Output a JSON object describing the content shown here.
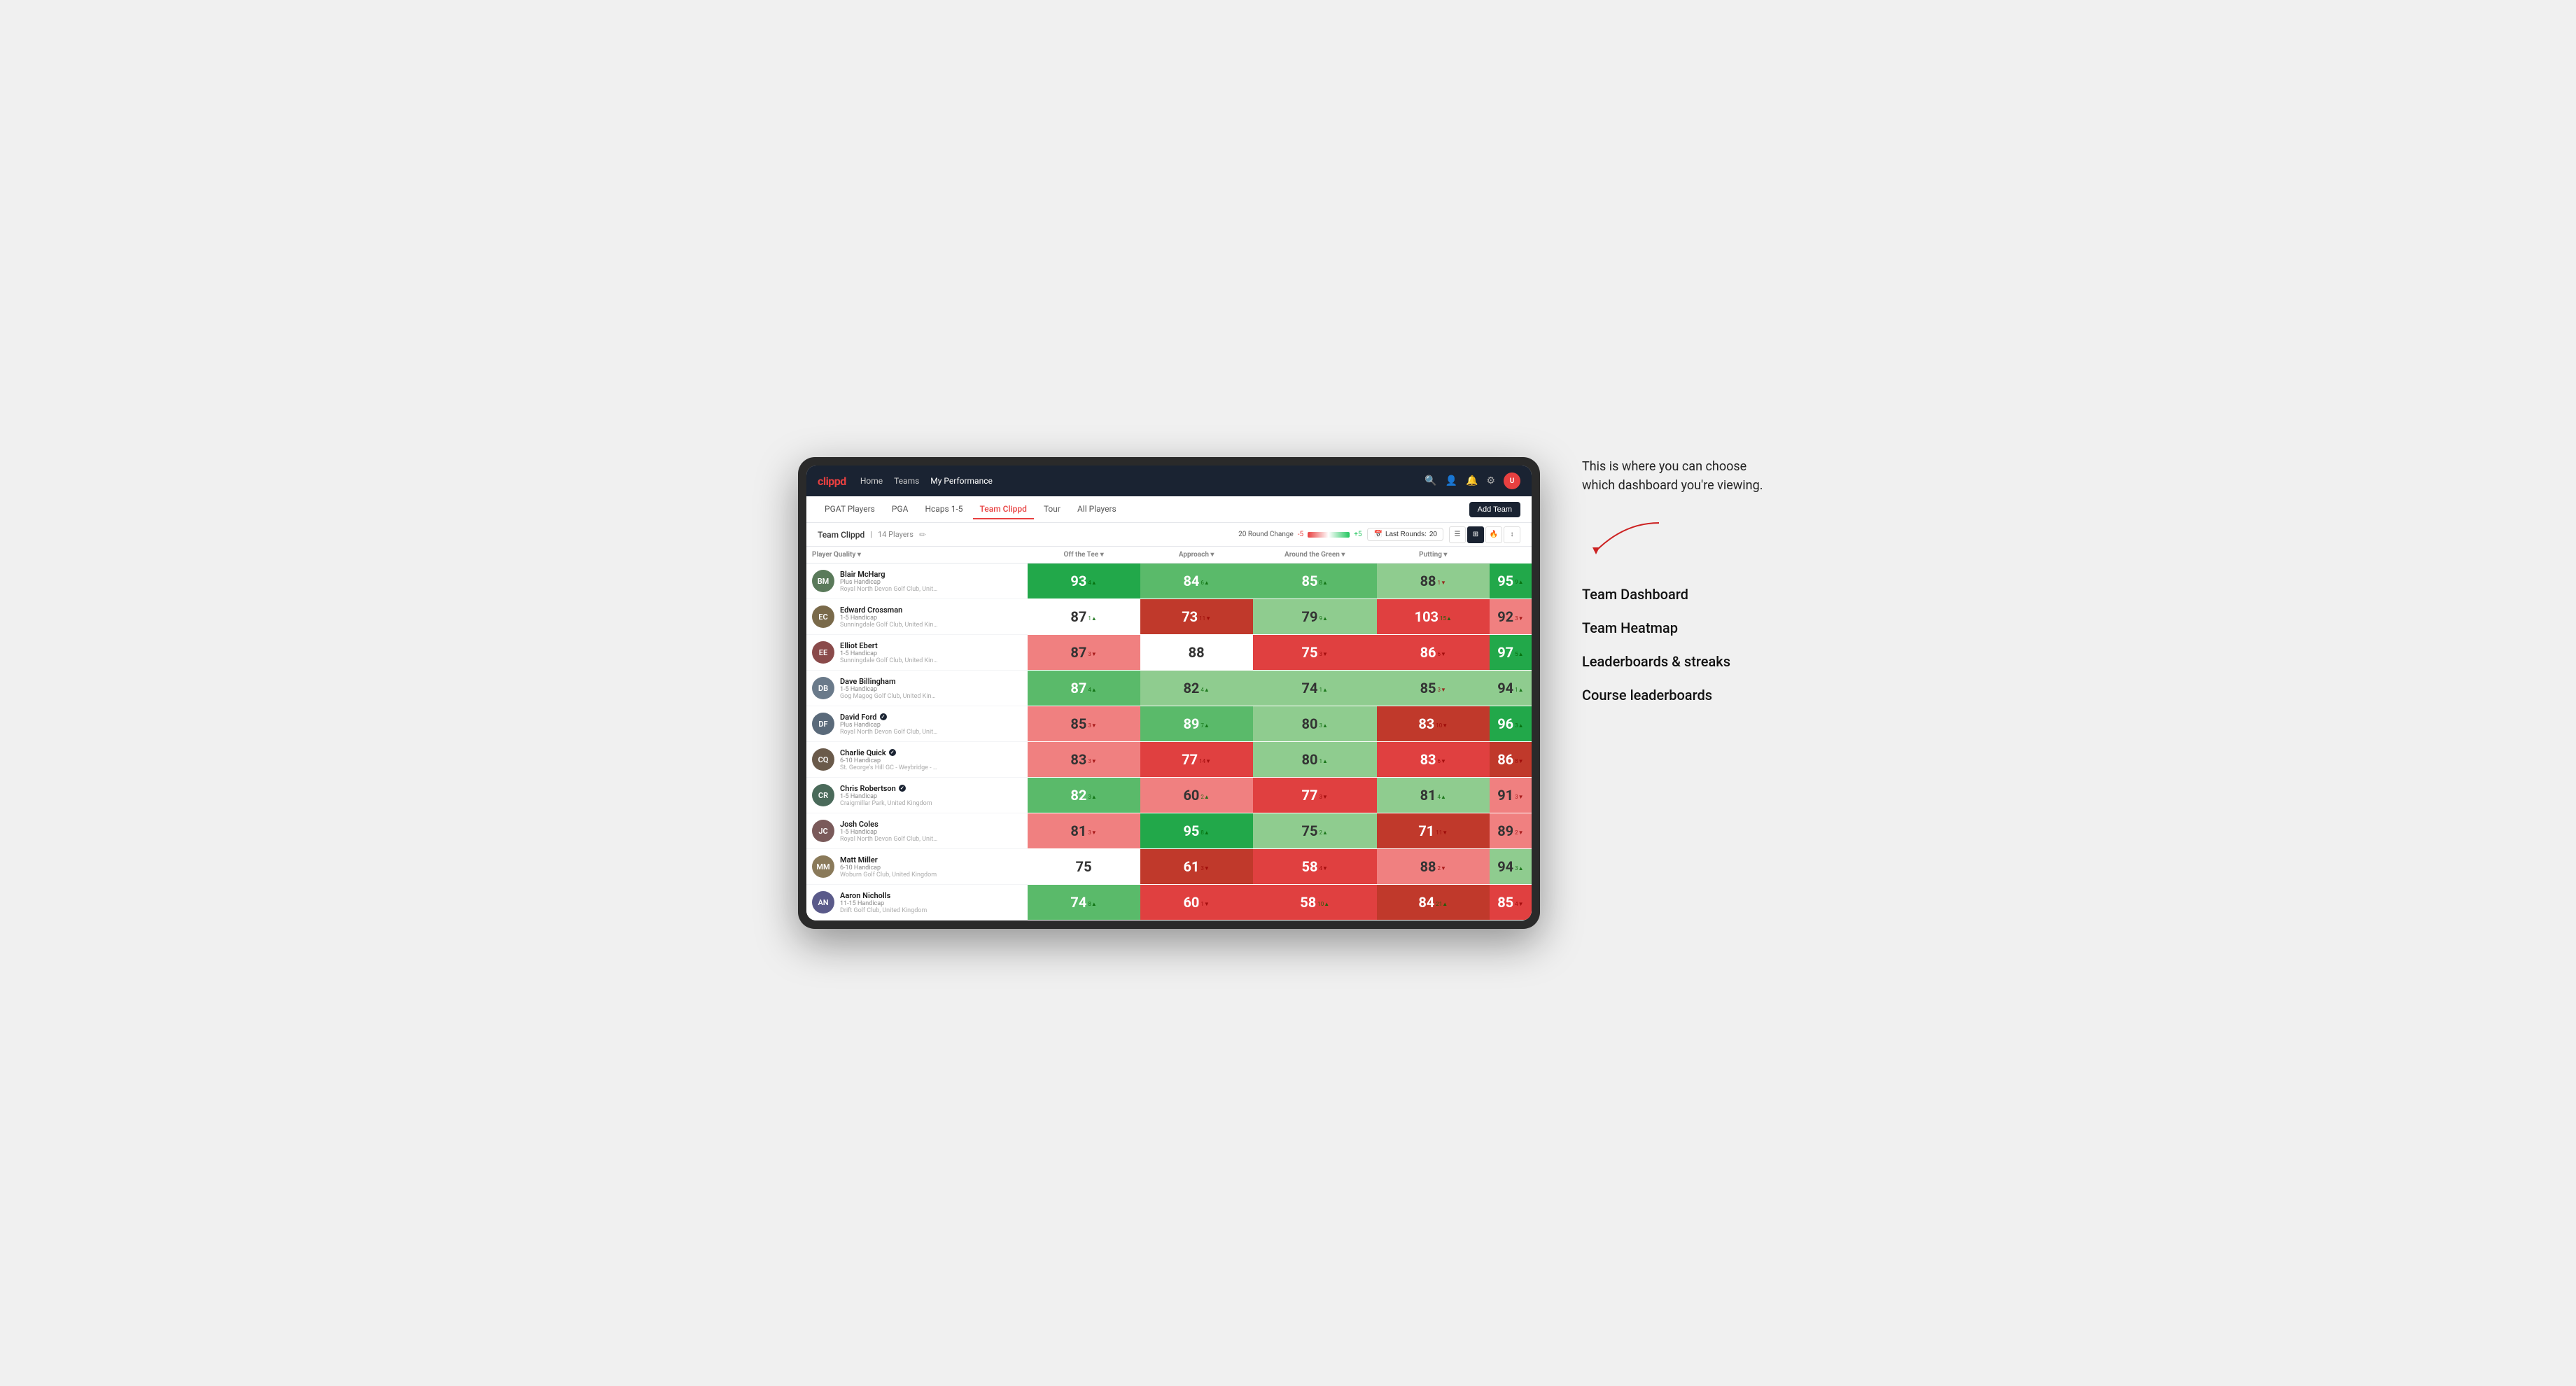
{
  "annotation": {
    "description": "This is where you can choose which dashboard you're viewing.",
    "arrow_direction": "left-down"
  },
  "sidebar": {
    "title": "Team Dashboard",
    "options": [
      {
        "label": "Team Dashboard"
      },
      {
        "label": "Team Heatmap"
      },
      {
        "label": "Leaderboards & streaks"
      },
      {
        "label": "Course leaderboards"
      }
    ]
  },
  "nav": {
    "logo": "clippd",
    "links": [
      {
        "label": "Home",
        "active": false
      },
      {
        "label": "Teams",
        "active": false
      },
      {
        "label": "My Performance",
        "active": true
      }
    ],
    "icons": [
      "search",
      "person",
      "bell",
      "settings",
      "avatar"
    ]
  },
  "subnav": {
    "links": [
      {
        "label": "PGAT Players",
        "active": false
      },
      {
        "label": "PGA",
        "active": false
      },
      {
        "label": "Hcaps 1-5",
        "active": false
      },
      {
        "label": "Team Clippd",
        "active": true
      },
      {
        "label": "Tour",
        "active": false
      },
      {
        "label": "All Players",
        "active": false
      }
    ],
    "add_team": "Add Team"
  },
  "team_bar": {
    "name": "Team Clippd",
    "separator": "|",
    "count": "14 Players",
    "round_change_label": "20 Round Change",
    "change_neg": "-5",
    "change_pos": "+5",
    "last_rounds_label": "Last Rounds:",
    "last_rounds_value": "20"
  },
  "table": {
    "columns": [
      {
        "label": "Player Quality ▾",
        "key": "quality"
      },
      {
        "label": "Off the Tee ▾",
        "key": "offTee"
      },
      {
        "label": "Approach ▾",
        "key": "approach"
      },
      {
        "label": "Around the Green ▾",
        "key": "aroundGreen"
      },
      {
        "label": "Putting ▾",
        "key": "putting"
      }
    ],
    "rows": [
      {
        "name": "Blair McHarg",
        "badge": false,
        "handicap": "Plus Handicap",
        "club": "Royal North Devon Golf Club, United Kingdom",
        "initials": "BM",
        "avatarColor": "#5a7a5a",
        "quality": {
          "value": 93,
          "change": 4,
          "dir": "up",
          "bg": "bg-green-dark"
        },
        "offTee": {
          "value": 84,
          "change": 6,
          "dir": "up",
          "bg": "bg-green-mid"
        },
        "approach": {
          "value": 85,
          "change": 8,
          "dir": "up",
          "bg": "bg-green-mid"
        },
        "aroundGreen": {
          "value": 88,
          "change": 1,
          "dir": "down",
          "bg": "bg-green-light"
        },
        "putting": {
          "value": 95,
          "change": 9,
          "dir": "up",
          "bg": "bg-green-dark"
        }
      },
      {
        "name": "Edward Crossman",
        "badge": false,
        "handicap": "1-5 Handicap",
        "club": "Sunningdale Golf Club, United Kingdom",
        "initials": "EC",
        "avatarColor": "#7a6a4a",
        "quality": {
          "value": 87,
          "change": 1,
          "dir": "up",
          "bg": "bg-white"
        },
        "offTee": {
          "value": 73,
          "change": 11,
          "dir": "down",
          "bg": "bg-red-dark"
        },
        "approach": {
          "value": 79,
          "change": 9,
          "dir": "up",
          "bg": "bg-green-light"
        },
        "aroundGreen": {
          "value": 103,
          "change": 15,
          "dir": "up",
          "bg": "bg-red-mid"
        },
        "putting": {
          "value": 92,
          "change": 3,
          "dir": "down",
          "bg": "bg-red-light"
        }
      },
      {
        "name": "Elliot Ebert",
        "badge": false,
        "handicap": "1-5 Handicap",
        "club": "Sunningdale Golf Club, United Kingdom",
        "initials": "EE",
        "avatarColor": "#8a4a4a",
        "quality": {
          "value": 87,
          "change": 3,
          "dir": "down",
          "bg": "bg-red-light"
        },
        "offTee": {
          "value": 88,
          "change": null,
          "dir": null,
          "bg": "bg-white"
        },
        "approach": {
          "value": 75,
          "change": 3,
          "dir": "down",
          "bg": "bg-red-mid"
        },
        "aroundGreen": {
          "value": 86,
          "change": 6,
          "dir": "down",
          "bg": "bg-red-mid"
        },
        "putting": {
          "value": 97,
          "change": 5,
          "dir": "up",
          "bg": "bg-green-dark"
        }
      },
      {
        "name": "Dave Billingham",
        "badge": false,
        "handicap": "1-5 Handicap",
        "club": "Gog Magog Golf Club, United Kingdom",
        "initials": "DB",
        "avatarColor": "#6a7a8a",
        "quality": {
          "value": 87,
          "change": 4,
          "dir": "up",
          "bg": "bg-green-mid"
        },
        "offTee": {
          "value": 82,
          "change": 4,
          "dir": "up",
          "bg": "bg-green-light"
        },
        "approach": {
          "value": 74,
          "change": 1,
          "dir": "up",
          "bg": "bg-green-light"
        },
        "aroundGreen": {
          "value": 85,
          "change": 3,
          "dir": "down",
          "bg": "bg-green-light"
        },
        "putting": {
          "value": 94,
          "change": 1,
          "dir": "up",
          "bg": "bg-green-light"
        }
      },
      {
        "name": "David Ford",
        "badge": true,
        "handicap": "Plus Handicap",
        "club": "Royal North Devon Golf Club, United Kingdom",
        "initials": "DF",
        "avatarColor": "#5a6a7a",
        "quality": {
          "value": 85,
          "change": 3,
          "dir": "down",
          "bg": "bg-red-light"
        },
        "offTee": {
          "value": 89,
          "change": 7,
          "dir": "up",
          "bg": "bg-green-mid"
        },
        "approach": {
          "value": 80,
          "change": 3,
          "dir": "up",
          "bg": "bg-green-light"
        },
        "aroundGreen": {
          "value": 83,
          "change": 10,
          "dir": "down",
          "bg": "bg-red-dark"
        },
        "putting": {
          "value": 96,
          "change": 3,
          "dir": "up",
          "bg": "bg-green-dark"
        }
      },
      {
        "name": "Charlie Quick",
        "badge": true,
        "handicap": "6-10 Handicap",
        "club": "St. George's Hill GC - Weybridge - Surrey, Uni...",
        "initials": "CQ",
        "avatarColor": "#6a5a4a",
        "quality": {
          "value": 83,
          "change": 3,
          "dir": "down",
          "bg": "bg-red-light"
        },
        "offTee": {
          "value": 77,
          "change": 14,
          "dir": "down",
          "bg": "bg-red-mid"
        },
        "approach": {
          "value": 80,
          "change": 1,
          "dir": "up",
          "bg": "bg-green-light"
        },
        "aroundGreen": {
          "value": 83,
          "change": 6,
          "dir": "down",
          "bg": "bg-red-mid"
        },
        "putting": {
          "value": 86,
          "change": 8,
          "dir": "down",
          "bg": "bg-red-dark"
        }
      },
      {
        "name": "Chris Robertson",
        "badge": true,
        "handicap": "1-5 Handicap",
        "club": "Craigmillar Park, United Kingdom",
        "initials": "CR",
        "avatarColor": "#4a6a5a",
        "quality": {
          "value": 82,
          "change": 3,
          "dir": "up",
          "bg": "bg-green-mid"
        },
        "offTee": {
          "value": 60,
          "change": 2,
          "dir": "up",
          "bg": "bg-red-light"
        },
        "approach": {
          "value": 77,
          "change": 3,
          "dir": "down",
          "bg": "bg-red-mid"
        },
        "aroundGreen": {
          "value": 81,
          "change": 4,
          "dir": "up",
          "bg": "bg-green-light"
        },
        "putting": {
          "value": 91,
          "change": 3,
          "dir": "down",
          "bg": "bg-red-light"
        }
      },
      {
        "name": "Josh Coles",
        "badge": false,
        "handicap": "1-5 Handicap",
        "club": "Royal North Devon Golf Club, United Kingdom",
        "initials": "JC",
        "avatarColor": "#7a5a5a",
        "quality": {
          "value": 81,
          "change": 3,
          "dir": "down",
          "bg": "bg-red-light"
        },
        "offTee": {
          "value": 95,
          "change": 8,
          "dir": "up",
          "bg": "bg-green-dark"
        },
        "approach": {
          "value": 75,
          "change": 2,
          "dir": "up",
          "bg": "bg-green-light"
        },
        "aroundGreen": {
          "value": 71,
          "change": 11,
          "dir": "down",
          "bg": "bg-red-dark"
        },
        "putting": {
          "value": 89,
          "change": 2,
          "dir": "down",
          "bg": "bg-red-light"
        }
      },
      {
        "name": "Matt Miller",
        "badge": false,
        "handicap": "6-10 Handicap",
        "club": "Woburn Golf Club, United Kingdom",
        "initials": "MM",
        "avatarColor": "#8a7a5a",
        "quality": {
          "value": 75,
          "change": null,
          "dir": null,
          "bg": "bg-white"
        },
        "offTee": {
          "value": 61,
          "change": 3,
          "dir": "down",
          "bg": "bg-red-dark"
        },
        "approach": {
          "value": 58,
          "change": 4,
          "dir": "down",
          "bg": "bg-red-mid"
        },
        "aroundGreen": {
          "value": 88,
          "change": 2,
          "dir": "down",
          "bg": "bg-red-light"
        },
        "putting": {
          "value": 94,
          "change": 3,
          "dir": "up",
          "bg": "bg-green-light"
        }
      },
      {
        "name": "Aaron Nicholls",
        "badge": false,
        "handicap": "11-15 Handicap",
        "club": "Drift Golf Club, United Kingdom",
        "initials": "AN",
        "avatarColor": "#5a5a8a",
        "quality": {
          "value": 74,
          "change": 8,
          "dir": "up",
          "bg": "bg-green-mid"
        },
        "offTee": {
          "value": 60,
          "change": 1,
          "dir": "down",
          "bg": "bg-red-mid"
        },
        "approach": {
          "value": 58,
          "change": 10,
          "dir": "up",
          "bg": "bg-red-mid"
        },
        "aroundGreen": {
          "value": 84,
          "change": 21,
          "dir": "up",
          "bg": "bg-red-dark"
        },
        "putting": {
          "value": 85,
          "change": 4,
          "dir": "down",
          "bg": "bg-red-mid"
        }
      }
    ]
  }
}
